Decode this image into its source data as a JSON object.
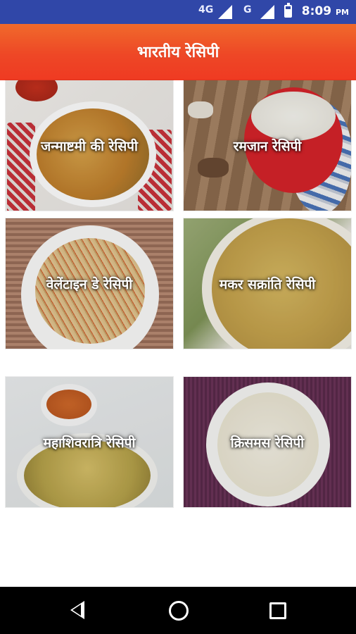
{
  "status_bar": {
    "network_1": "4G",
    "network_2": "G",
    "time": "8:09",
    "ampm": "PM"
  },
  "header": {
    "title": "भारतीय रेसिपी",
    "color_top": "#f06a2b",
    "color_bottom": "#ef3a22"
  },
  "tiles": [
    {
      "label": "जन्माष्टमी की रेसिपी"
    },
    {
      "label": "रमजान रेसिपी"
    },
    {
      "label": "वेलेंटाइन डे रेसिपी"
    },
    {
      "label": "मकर सक्रांति रेसिपी"
    },
    {
      "label": "महाशिवरात्रि रेसिपी"
    },
    {
      "label": "क्रिसमस रेसिपी"
    }
  ],
  "nav_bar": {
    "icons": [
      "back-icon",
      "home-icon",
      "recents-icon"
    ]
  }
}
